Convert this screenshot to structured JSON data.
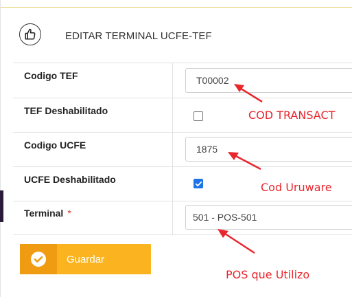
{
  "header": {
    "title": "EDITAR TERMINAL UCFE-TEF"
  },
  "form": {
    "codigo_tef": {
      "label": "Codigo TEF",
      "value": "T00002"
    },
    "tef_deshabilitado": {
      "label": "TEF Deshabilitado",
      "checked": false
    },
    "codigo_ucfe": {
      "label": "Codigo UCFE",
      "value": "1875"
    },
    "ucfe_deshabilitado": {
      "label": "UCFE Deshabilitado",
      "checked": true
    },
    "terminal": {
      "label": "Terminal",
      "required_mark": "*",
      "value": "501 - POS-501"
    }
  },
  "actions": {
    "save_label": "Guardar"
  },
  "annotations": {
    "cod_transact": "COD TRANSACT",
    "cod_uruware": "Cod Uruware",
    "pos_que_utilizo": "POS que Utilizo"
  },
  "colors": {
    "accent": "#fbb41f",
    "accent_dark": "#f09c12",
    "annotation": "#e8262d",
    "checkbox": "#1e73e8"
  },
  "icons": {
    "header": "thumbs-up-icon",
    "save": "check-circle-icon"
  }
}
